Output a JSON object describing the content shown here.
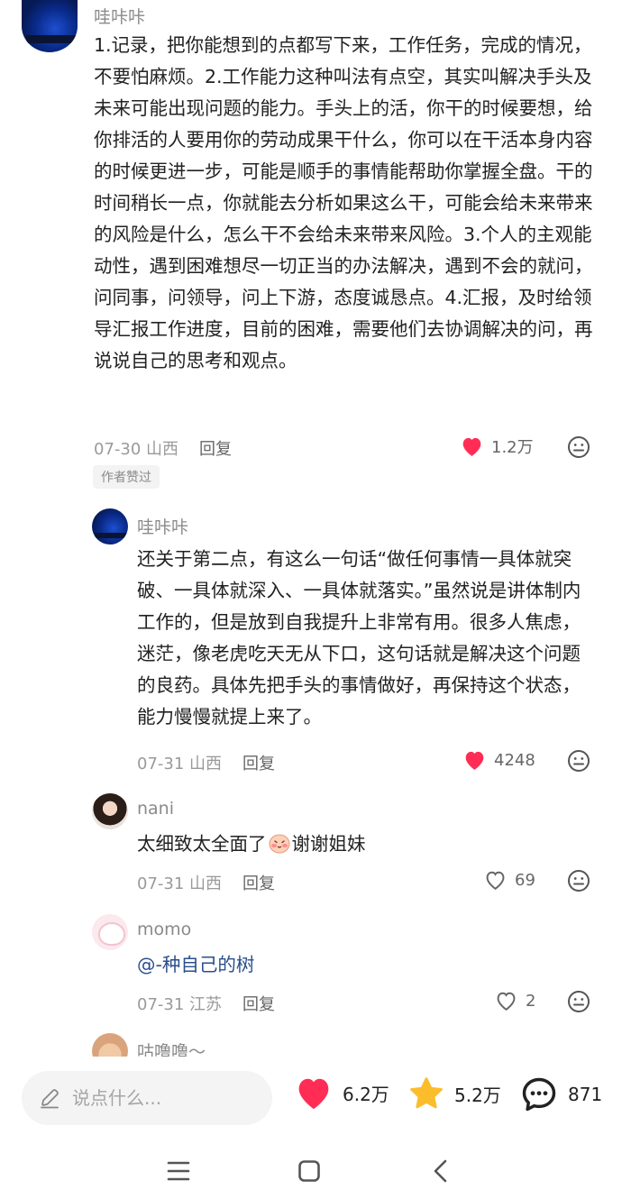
{
  "comments": [
    {
      "username": "哇咔咔",
      "text": "1.记录，把你能想到的点都写下来，工作任务，完成的情况，不要怕麻烦。2.工作能力这种叫法有点空，其实叫解决手头及未来可能出现问题的能力。手头上的活，你干的时候要想，给你排活的人要用你的劳动成果干什么，你可以在干活本身内容的时候更进一步，可能是顺手的事情能帮助你掌握全盘。干的时间稍长一点，你就能去分析如果这么干，可能会给未来带来的风险是什么，怎么干不会给未来带来风险。3.个人的主观能动性，遇到困难想尽一切正当的办法解决，遇到不会的就问，问同事，问领导，问上下游，态度诚恳点。4.汇报，及时给领导汇报工作进度，目前的困难，需要他们去协调解决的问，再说说自己的思考和观点。",
      "date_location": "07-30 山西",
      "reply_label": "回复",
      "likes": "1.2万",
      "liked": true,
      "badge": "作者赞过"
    },
    {
      "username": "哇咔咔",
      "text": "还关于第二点，有这么一句话“做任何事情一具体就突破、一具体就深入、一具体就落实。”虽然说是讲体制内工作的，但是放到自我提升上非常有用。很多人焦虑，迷茫，像老虎吃天无从下口，这句话就是解决这个问题的良药。具体先把手头的事情做好，再保持这个状态，能力慢慢就提上来了。",
      "date_location": "07-31 山西",
      "reply_label": "回复",
      "likes": "4248",
      "liked": true
    },
    {
      "username": "nani",
      "text_before": "太细致太全面了",
      "text_after": "谢谢姐妹",
      "date_location": "07-31 山西",
      "reply_label": "回复",
      "likes": "69",
      "liked": false
    },
    {
      "username": "momo",
      "mention": "@-种自己的树",
      "date_location": "07-31 江苏",
      "reply_label": "回复",
      "likes": "2",
      "liked": false
    },
    {
      "username": "咕噜噜～"
    }
  ],
  "bottom_bar": {
    "input_placeholder": "说点什么...",
    "likes_count": "6.2万",
    "favorites_count": "5.2万",
    "comments_count": "871"
  },
  "colors": {
    "like_red": "#ff2d55",
    "star_yellow": "#fbbd2c"
  }
}
